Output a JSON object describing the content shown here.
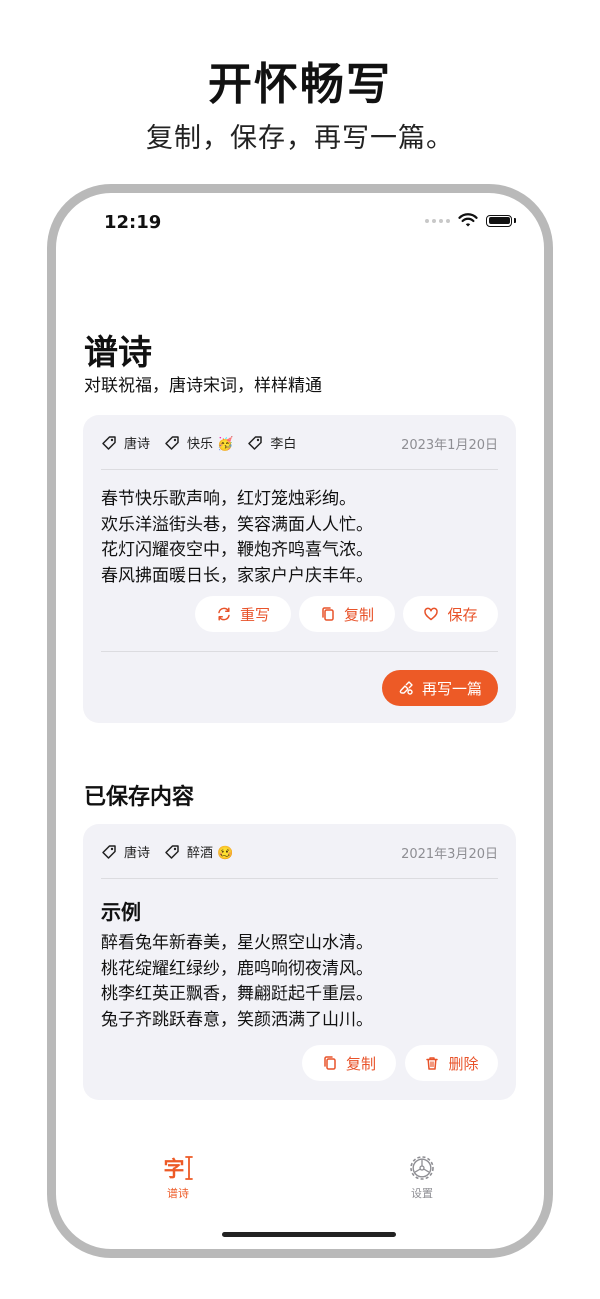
{
  "promo": {
    "title": "开怀畅写",
    "subtitle": "复制，保存，再写一篇。"
  },
  "status_bar": {
    "time": "12:19"
  },
  "header": {
    "title": "谱诗",
    "subtitle": "对联祝福，唐诗宋词，样样精通"
  },
  "current_poem": {
    "tags": [
      "唐诗",
      "快乐 🥳",
      "李白"
    ],
    "date": "2023年1月20日",
    "lines": [
      "春节快乐歌声响，红灯笼烛彩绚。",
      "欢乐洋溢街头巷，笑容满面人人忙。",
      "花灯闪耀夜空中，鞭炮齐鸣喜气浓。",
      "春风拂面暖日长，家家户户庆丰年。"
    ],
    "actions": {
      "rewrite": "重写",
      "copy": "复制",
      "save": "保存"
    },
    "write_another": "再写一篇"
  },
  "saved_section": {
    "title": "已保存内容"
  },
  "saved_poem": {
    "tags": [
      "唐诗",
      "醉酒 🥴"
    ],
    "date": "2021年3月20日",
    "title": "示例",
    "lines": [
      "醉看兔年新春美，星火照空山水清。",
      "桃花绽耀红绿纱，鹿鸣响彻夜清风。",
      "桃李红英正飘香，舞翩跹起千重层。",
      "兔子齐跳跃春意，笑颜洒满了山川。"
    ],
    "actions": {
      "copy": "复制",
      "delete": "删除"
    }
  },
  "tabbar": {
    "items": [
      {
        "label": "谱诗",
        "glyph": "字",
        "active": true,
        "icon": "character-cursor-icon"
      },
      {
        "label": "设置",
        "active": false,
        "icon": "gear-icon"
      }
    ]
  },
  "colors": {
    "accent": "#ed5a26",
    "card": "#f2f2f7",
    "muted": "#8e8e93"
  }
}
